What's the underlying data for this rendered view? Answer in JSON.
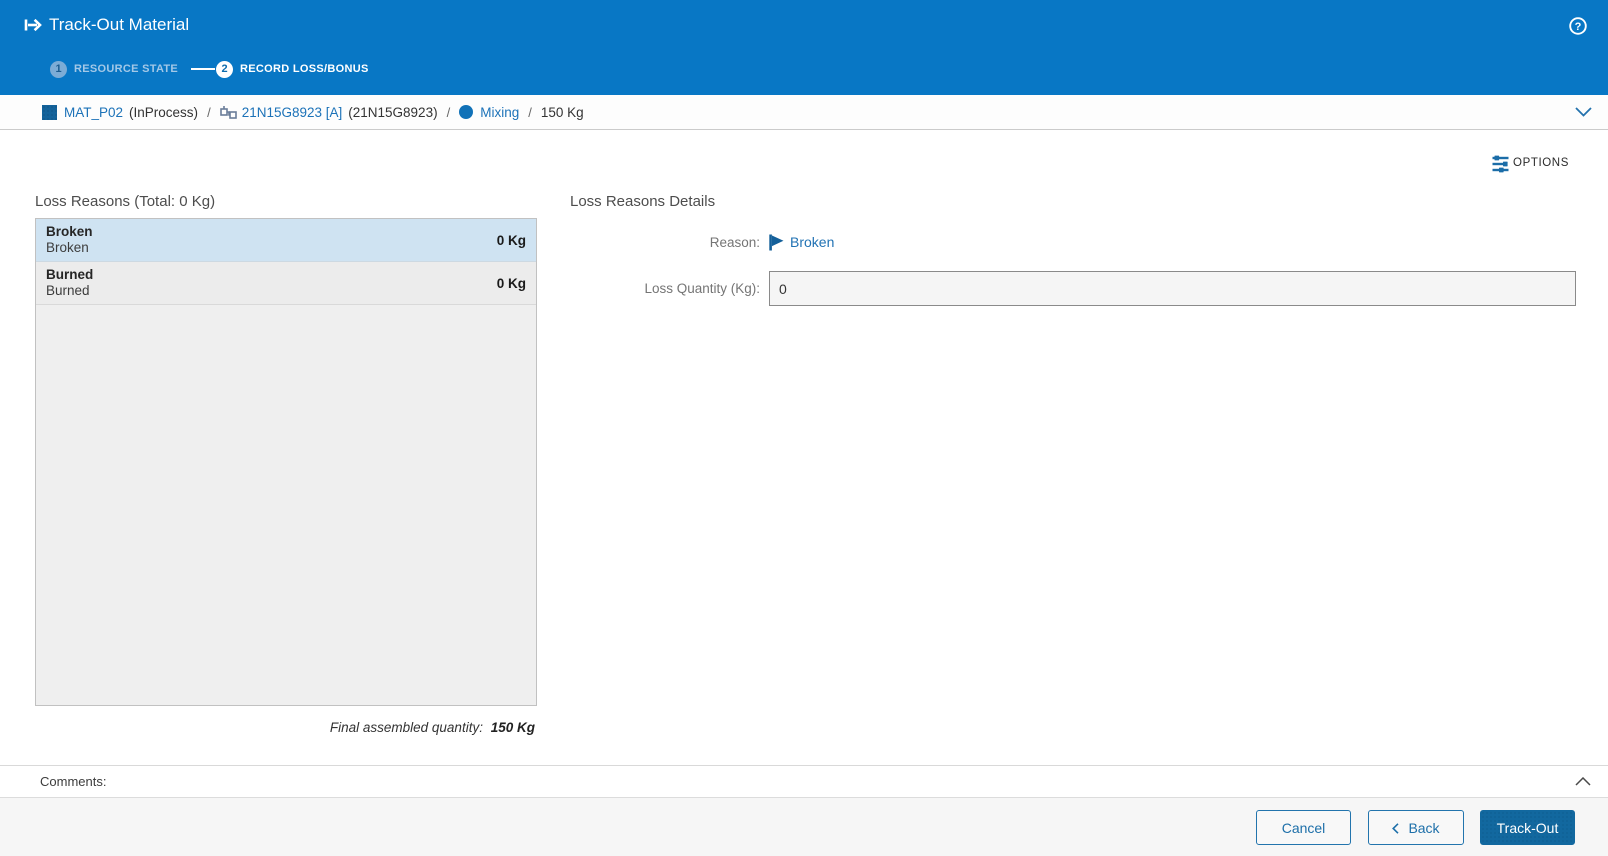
{
  "header": {
    "title": "Track-Out Material",
    "icon": "track-out-arrow",
    "help_icon": "help-circled-question-mark",
    "steps": [
      {
        "number": "1",
        "label": "RESOURCE STATE",
        "state": "done"
      },
      {
        "number": "2",
        "label": "RECORD LOSS/BONUS",
        "state": "active"
      }
    ]
  },
  "breadcrumb": {
    "separator": "/",
    "material": {
      "icon": "material-square",
      "name": "MAT_P02",
      "state": "(InProcess)"
    },
    "flow": {
      "icon": "flow-step",
      "name": "21N15G8923 [A]",
      "detail": "(21N15G8923)"
    },
    "step": {
      "icon": "step-dot",
      "name": "Mixing"
    },
    "quantity": "150 Kg",
    "expander_icon": "chevron-down"
  },
  "options": {
    "label": "OPTIONS",
    "icon": "sliders"
  },
  "loss_reasons": {
    "title": "Loss Reasons (Total: 0 Kg)",
    "items": [
      {
        "name": "Broken",
        "description": "Broken",
        "quantity": "0 Kg",
        "selected": true
      },
      {
        "name": "Burned",
        "description": "Burned",
        "quantity": "0 Kg",
        "selected": false
      }
    ],
    "footnote_label": "Final assembled quantity:",
    "footnote_value": "150 Kg"
  },
  "details": {
    "title": "Loss Reasons Details",
    "reason_label": "Reason:",
    "reason_icon": "flag",
    "reason_value": "Broken",
    "quantity_label": "Loss Quantity (Kg):",
    "quantity_value": "0"
  },
  "comments": {
    "label": "Comments:",
    "expander_icon": "chevron-up"
  },
  "footer": {
    "cancel_label": "Cancel",
    "back_label": "Back",
    "back_icon": "chevron-left",
    "submit_label": "Track-Out"
  },
  "colors": {
    "header_blue": "#0877c5",
    "primary_button_blue": "#12689f",
    "link_blue": "#1c72b8",
    "selected_row_blue": "#cfe3f2",
    "list_gray": "#efefef",
    "footer_gray": "#f6f6f6"
  }
}
